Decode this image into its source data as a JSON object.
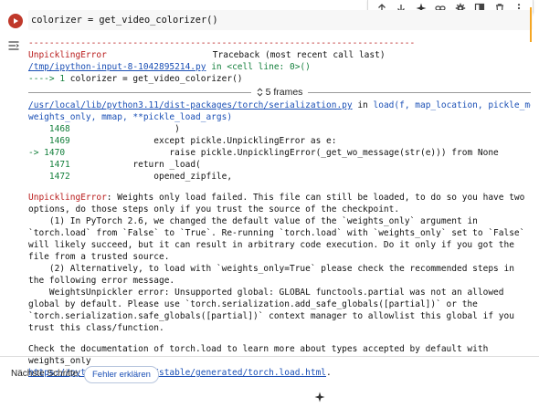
{
  "toolbar": {
    "icons": [
      "arrow-up-icon",
      "arrow-down-icon",
      "sparkle-icon",
      "link-icon",
      "gear-icon",
      "mirror-icon",
      "trash-icon",
      "more-icon"
    ]
  },
  "cell": {
    "code": "colorizer = get_video_colorizer()"
  },
  "output": {
    "dashes": "--------------------------------------------------------------------------",
    "error_name": "UnpicklingError",
    "traceback_label": "Traceback (most recent call last)",
    "input_file": "/tmp/ipython-input-8-1042895214.py",
    "in_cell": " in <cell line: 0>()",
    "arrow_line_prefix": "----> 1 ",
    "arrow_line_code": "colorizer = get_video_colorizer()",
    "frames_label": "5 frames",
    "lib_path": "/usr/local/lib/python3.11/dist-packages/torch/serialization.py",
    "lib_in": " in ",
    "lib_func": "load(f, map_location, pickle_module,",
    "lib_func_cont": "weights_only, mmap, **pickle_load_args)",
    "src": [
      {
        "no": "    1468",
        "code": "                    )"
      },
      {
        "no": "    1469",
        "code": "                except pickle.UnpicklingError as e:"
      },
      {
        "no": "-> 1470",
        "code": "                    raise pickle.UnpicklingError(_get_wo_message(str(e))) from None"
      },
      {
        "no": "    1471",
        "code": "            return _load("
      },
      {
        "no": "    1472",
        "code": "                opened_zipfile,"
      }
    ],
    "message_head": "UnpicklingError",
    "message_body": ": Weights only load failed. This file can still be loaded, to do so you have two options, do those steps only if you trust the source of the checkpoint.\n    (1) In PyTorch 2.6, we changed the default value of the `weights_only` argument in `torch.load` from `False` to `True`. Re-running `torch.load` with `weights_only` set to `False` will likely succeed, but it can result in arbitrary code execution. Do it only if you got the file from a trusted source.\n    (2) Alternatively, to load with `weights_only=True` please check the recommended steps in the following error message.\n    WeightsUnpickler error: Unsupported global: GLOBAL functools.partial was not an allowed global by default. Please use `torch.serialization.add_safe_globals([partial])` or the `torch.serialization.safe_globals([partial])` context manager to allowlist this global if you trust this class/function.",
    "docs_text": "Check the documentation of torch.load to learn more about types accepted by default with weights_only",
    "docs_url": "https://pytorch.org/docs/stable/generated/torch.load.html",
    "docs_period": "."
  },
  "footer": {
    "next_steps_label": "Nächste Schritte:",
    "explain_error_button": "Fehler erklären"
  },
  "colors": {
    "error_red": "#b91c1c",
    "link_blue": "#1a4fb5",
    "keyword_green": "#15803d",
    "run_button": "#c0392b",
    "cell_accent": "#f5a623"
  }
}
